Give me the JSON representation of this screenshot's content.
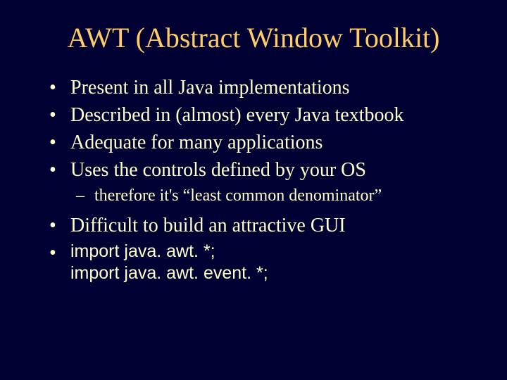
{
  "title": "AWT (Abstract Window Toolkit)",
  "bullets": {
    "b0": "Present in all Java implementations",
    "b1": "Described in (almost) every Java textbook",
    "b2": "Adequate for many applications",
    "b3": "Uses the controls defined by your OS",
    "sub0": "therefore it's “least common denominator”",
    "b4": "Difficult to build an attractive GUI",
    "b5a": "import java. awt. *;",
    "b5b": "import java. awt. event. *;"
  },
  "glyphs": {
    "dot": "•",
    "dash": "–"
  }
}
